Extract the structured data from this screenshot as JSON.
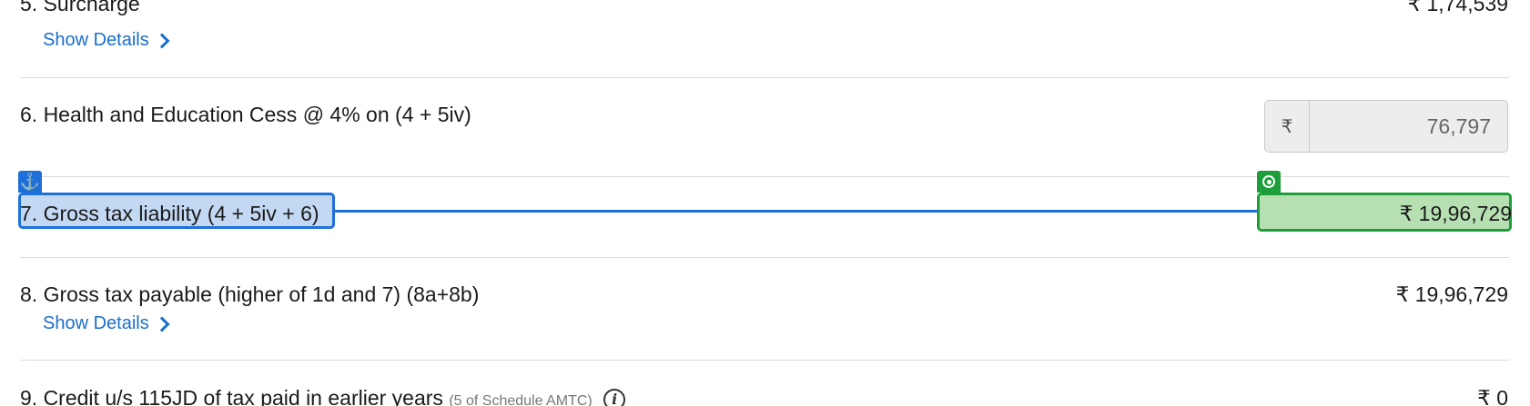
{
  "rows": {
    "surcharge": {
      "label": "5. Surcharge",
      "amount": "₹ 1,74,539",
      "link": "Show Details"
    },
    "cess": {
      "label": "6. Health and Education Cess @ 4% on (4 + 5iv)",
      "currency_symbol": "₹",
      "value": "76,797"
    },
    "gross_liability": {
      "label": "7. Gross tax liability (4 + 5iv + 6)",
      "amount": "₹ 19,96,729"
    },
    "gross_payable": {
      "label": "8. Gross tax payable (higher of 1d and 7) (8a+8b)",
      "amount": "₹ 19,96,729",
      "link": "Show Details"
    },
    "credit": {
      "label": "9. Credit u/s 115JD of tax paid in earlier years",
      "note": "(5 of Schedule AMTC)",
      "info_icon": "i",
      "amount": "₹ 0"
    }
  },
  "overlay": {
    "anchor_icon": "⚓",
    "anchor_color": "#1e6fd9",
    "target_color": "#1e9e3a"
  }
}
